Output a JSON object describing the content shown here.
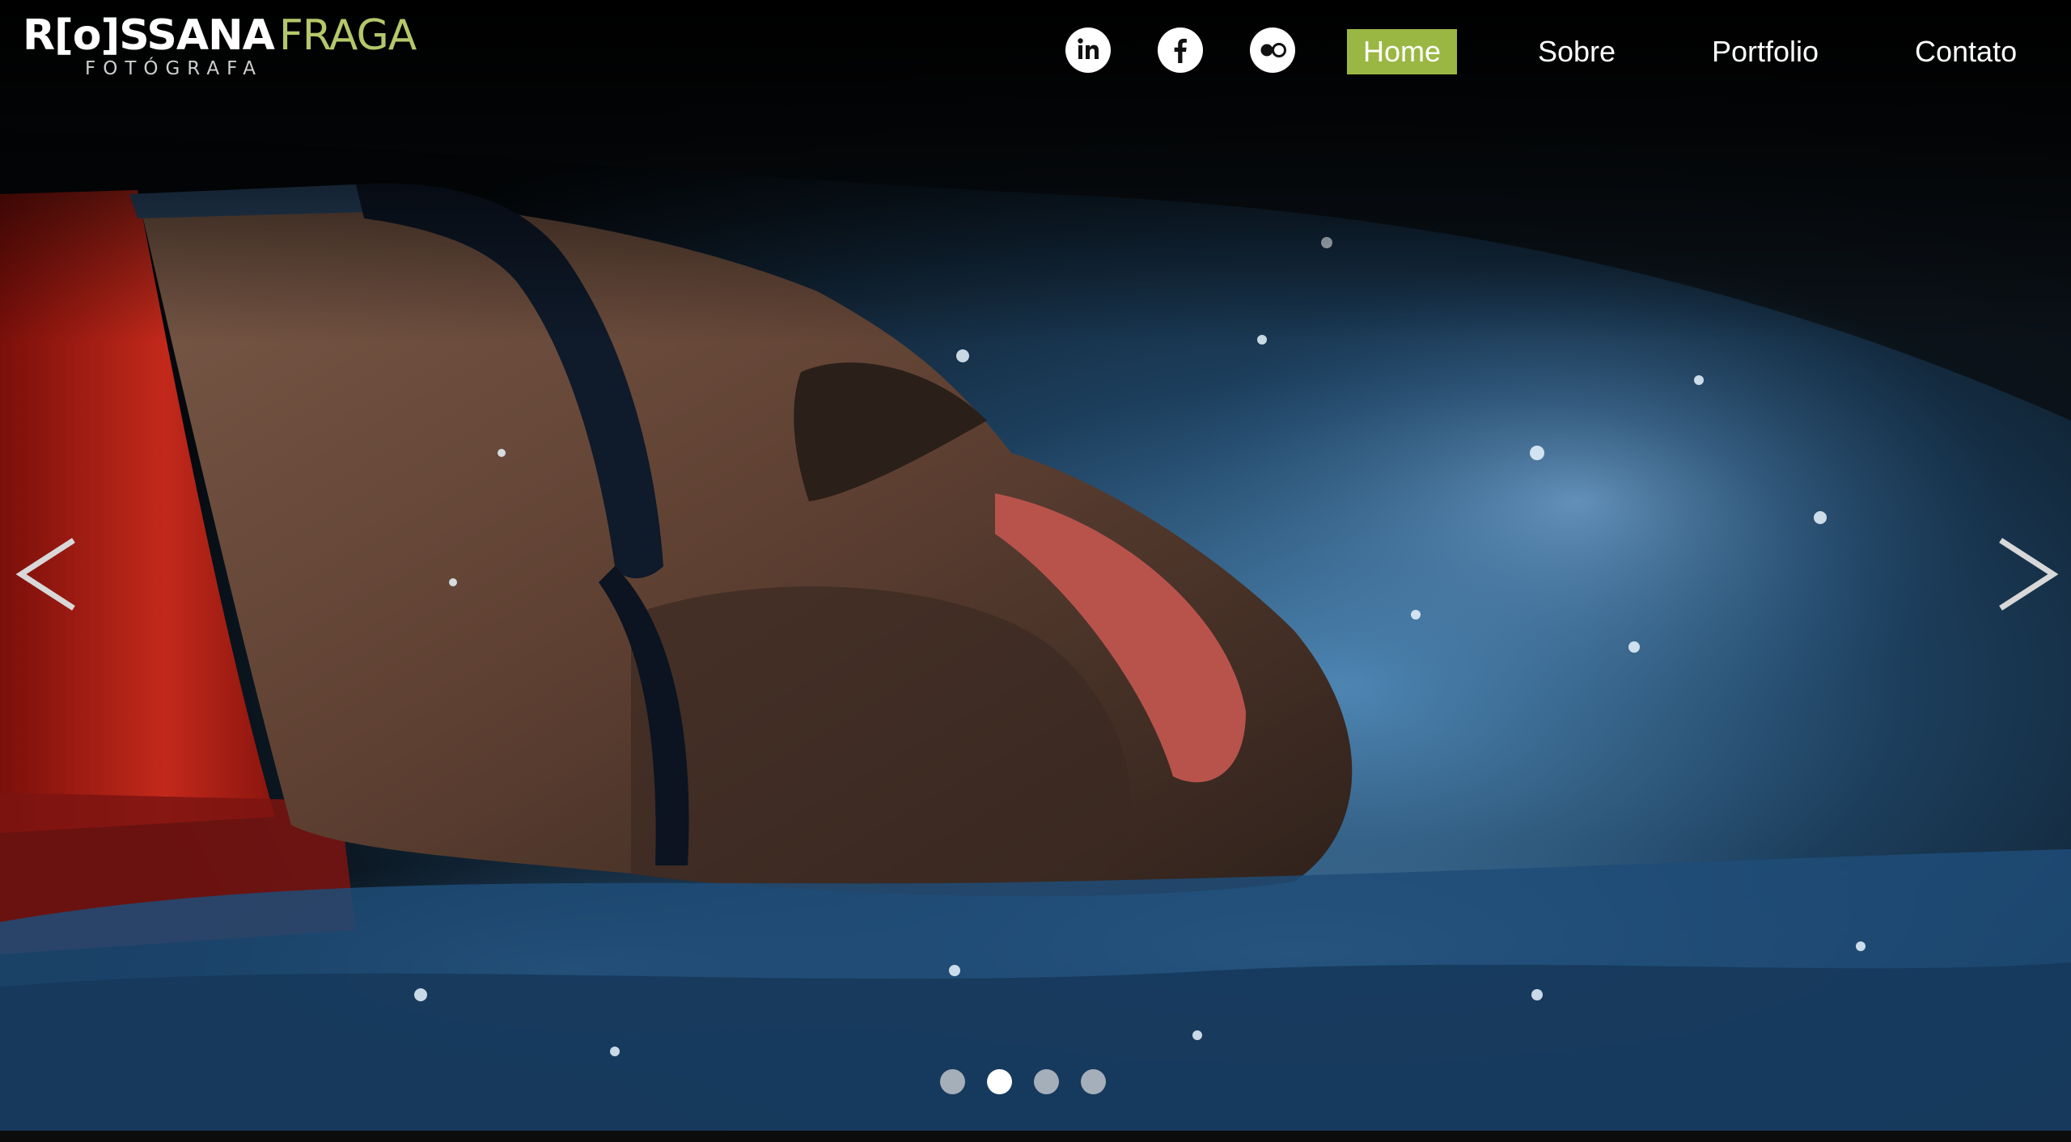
{
  "brand": {
    "first_name": "R[o]SSANA",
    "last_name": "FRAGA",
    "subtitle": "FOTÓGRAFA",
    "accent_color": "#b4c86a"
  },
  "social": [
    {
      "name": "linkedin-icon",
      "glyph": "in"
    },
    {
      "name": "facebook-icon",
      "glyph": "f"
    },
    {
      "name": "flickr-icon",
      "glyph": "flickr-dots"
    }
  ],
  "nav": {
    "items": [
      {
        "label": "Home",
        "active": true
      },
      {
        "label": "Sobre",
        "active": false
      },
      {
        "label": "Portfolio",
        "active": false
      },
      {
        "label": "Contato",
        "active": false
      }
    ],
    "active_color": "#9bb743"
  },
  "slider": {
    "prev_icon": "chevron-left-icon",
    "next_icon": "chevron-right-icon",
    "slide_count": 4,
    "active_slide": 2
  }
}
